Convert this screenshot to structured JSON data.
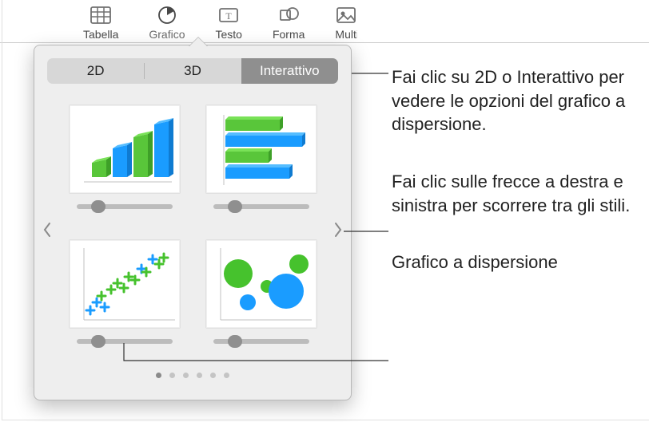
{
  "toolbar": {
    "table": "Tabella",
    "chart": "Grafico",
    "text": "Testo",
    "shape": "Forma",
    "media": "Multi"
  },
  "popover": {
    "tabs": {
      "a": "2D",
      "b": "3D",
      "c": "Interattivo"
    },
    "thumbs": {
      "bar": "interactive-bar-chart",
      "hbar": "interactive-horizontal-bar-chart",
      "scatter": "interactive-scatter-chart",
      "bubble": "interactive-bubble-chart"
    },
    "page_count": 6,
    "active_page": 0
  },
  "annotations": {
    "a1": "Fai clic su 2D o Interattivo per vedere le opzioni del grafico a dispersione.",
    "a2": "Fai clic sulle frecce a destra e sinistra per scorrere tra gli stili.",
    "a3": "Grafico a dispersione"
  }
}
